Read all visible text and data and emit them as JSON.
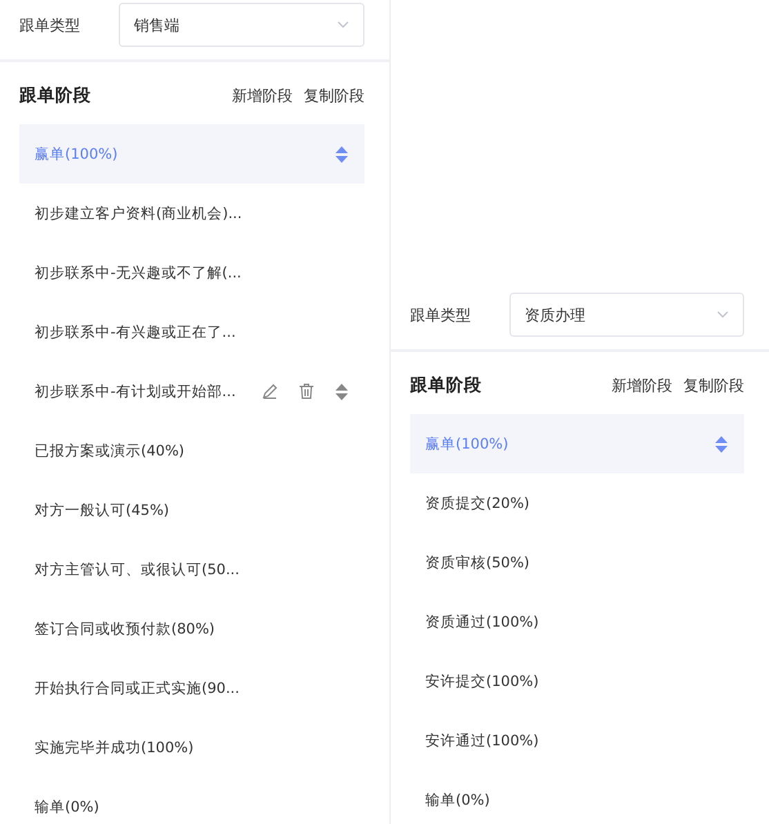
{
  "panels": [
    {
      "type_label": "跟单类型",
      "type_value": "销售端",
      "stage_title": "跟单阶段",
      "actions": [
        "新增阶段",
        "复制阶段"
      ],
      "stages": [
        {
          "label": "赢单(100%)",
          "selected": true,
          "hovered": false
        },
        {
          "label": "初步建立客户资料(商业机会)...",
          "selected": false,
          "hovered": false
        },
        {
          "label": "初步联系中-无兴趣或不了解(...",
          "selected": false,
          "hovered": false
        },
        {
          "label": "初步联系中-有兴趣或正在了...",
          "selected": false,
          "hovered": false
        },
        {
          "label": "初步联系中-有计划或开始部...",
          "selected": false,
          "hovered": true
        },
        {
          "label": "已报方案或演示(40%)",
          "selected": false,
          "hovered": false
        },
        {
          "label": "对方一般认可(45%)",
          "selected": false,
          "hovered": false
        },
        {
          "label": "对方主管认可、或很认可(50...",
          "selected": false,
          "hovered": false
        },
        {
          "label": "签订合同或收预付款(80%)",
          "selected": false,
          "hovered": false
        },
        {
          "label": "开始执行合同或正式实施(90...",
          "selected": false,
          "hovered": false
        },
        {
          "label": "实施完毕并成功(100%)",
          "selected": false,
          "hovered": false
        },
        {
          "label": "输单(0%)",
          "selected": false,
          "hovered": false
        }
      ]
    },
    {
      "type_label": "跟单类型",
      "type_value": "资质办理",
      "stage_title": "跟单阶段",
      "actions": [
        "新增阶段",
        "复制阶段"
      ],
      "stages": [
        {
          "label": "赢单(100%)",
          "selected": true,
          "hovered": false
        },
        {
          "label": "资质提交(20%)",
          "selected": false,
          "hovered": false
        },
        {
          "label": "资质审核(50%)",
          "selected": false,
          "hovered": false
        },
        {
          "label": "资质通过(100%)",
          "selected": false,
          "hovered": false
        },
        {
          "label": "安许提交(100%)",
          "selected": false,
          "hovered": false
        },
        {
          "label": "安许通过(100%)",
          "selected": false,
          "hovered": false
        },
        {
          "label": "输单(0%)",
          "selected": false,
          "hovered": false
        }
      ]
    }
  ]
}
